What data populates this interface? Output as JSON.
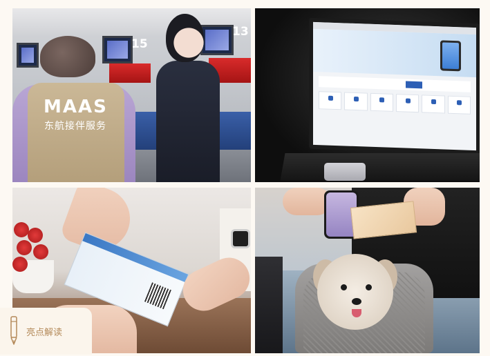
{
  "photos": [
    {
      "id": "airport-counter",
      "vest_title": "MAAS",
      "vest_subtitle": "东航接伴服务",
      "counter_numbers": [
        "15",
        "13"
      ]
    },
    {
      "id": "laptop-booking"
    },
    {
      "id": "boarding-pass-handover"
    },
    {
      "id": "pet-travel"
    }
  ],
  "highlight_tag": {
    "label": "亮点解读",
    "icon": "pen-icon"
  },
  "colors": {
    "page_background": "#fdf9f3",
    "tag_background": "#fbf5ec",
    "tag_text": "#b48a5a",
    "airline_blue": "#2d5fb5",
    "counter_red": "#d92b2b"
  }
}
